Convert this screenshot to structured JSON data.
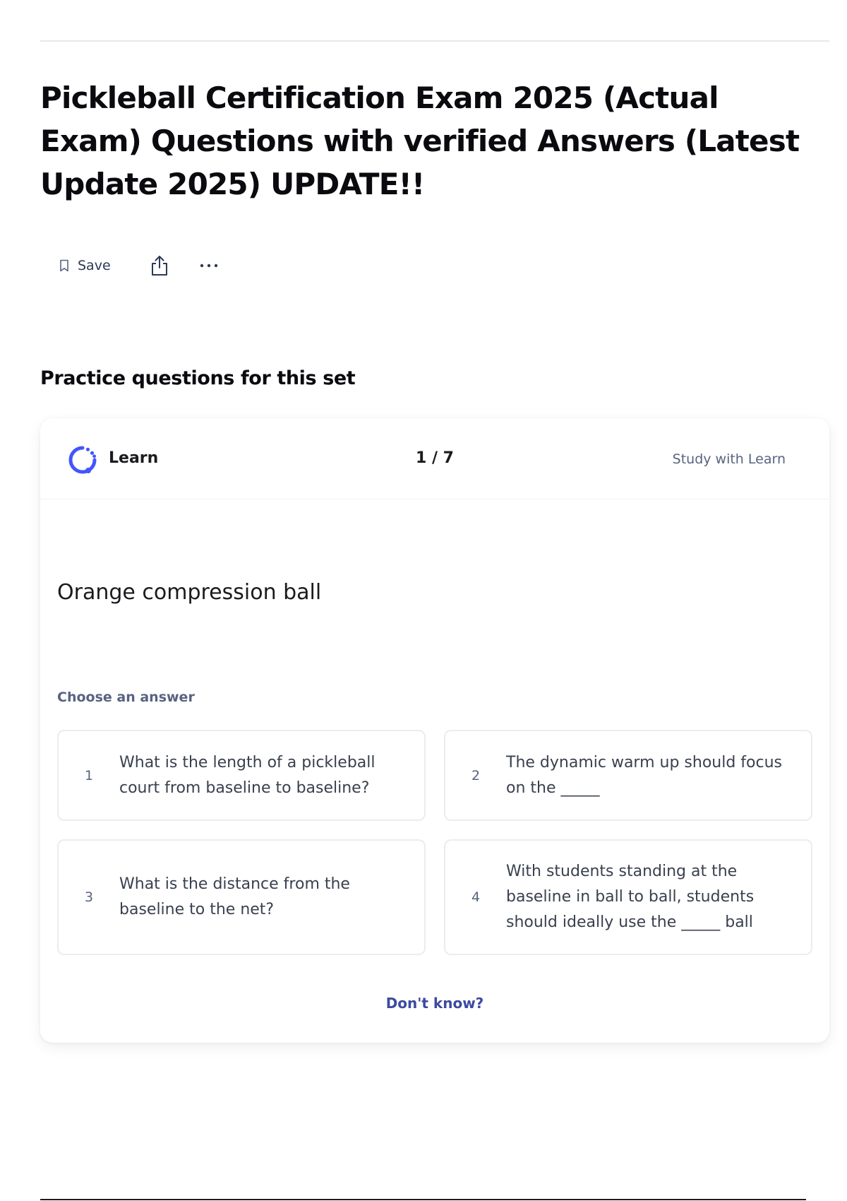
{
  "page": {
    "title": "Pickleball Certification Exam 2025 (Actual Exam) Questions with verified Answers (Latest Update 2025) UPDATE!!"
  },
  "actions": {
    "save_label": "Save",
    "icons": [
      "bookmark-icon",
      "share-icon",
      "more-icon"
    ]
  },
  "practice": {
    "section_title": "Practice questions for this set",
    "mode_label": "Learn",
    "progress": "1 / 7",
    "study_link": "Study with Learn",
    "term": "Orange compression ball",
    "prompt": "Choose an answer",
    "options": [
      {
        "number": "1",
        "text": "What is the length of a pickleball court from baseline to baseline?"
      },
      {
        "number": "2",
        "text": "The dynamic warm up should focus on the _____"
      },
      {
        "number": "3",
        "text": "What is the distance from the baseline to the net?"
      },
      {
        "number": "4",
        "text": "With students standing at the baseline in ball to ball, students should ideally use the _____ ball"
      }
    ],
    "dont_know": "Don't know?"
  },
  "colors": {
    "accent": "#4255ff",
    "link": "#3c4aa1",
    "muted_text": "#586380",
    "border": "#ebecf0"
  }
}
